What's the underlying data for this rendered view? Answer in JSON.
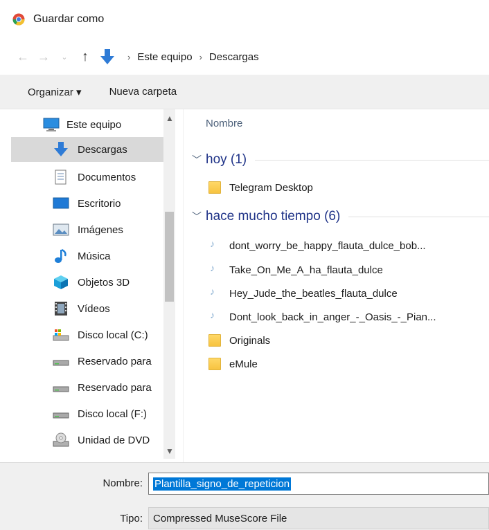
{
  "window": {
    "title": "Guardar como"
  },
  "address": {
    "crumbs": [
      "Este equipo",
      "Descargas"
    ]
  },
  "toolbar": {
    "organize": "Organizar ▾",
    "new_folder": "Nueva carpeta"
  },
  "nav": {
    "items": [
      {
        "label": "Este equipo",
        "icon": "computer-icon"
      },
      {
        "label": "Descargas",
        "icon": "downloads-icon",
        "selected": true
      },
      {
        "label": "Documentos",
        "icon": "document-icon"
      },
      {
        "label": "Escritorio",
        "icon": "desktop-icon"
      },
      {
        "label": "Imágenes",
        "icon": "pictures-icon"
      },
      {
        "label": "Música",
        "icon": "music-icon"
      },
      {
        "label": "Objetos 3D",
        "icon": "3d-objects-icon"
      },
      {
        "label": "Vídeos",
        "icon": "videos-icon"
      },
      {
        "label": "Disco local (C:)",
        "icon": "drive-icon"
      },
      {
        "label": "Reservado para",
        "icon": "drive-icon"
      },
      {
        "label": "Reservado para",
        "icon": "drive-icon"
      },
      {
        "label": "Disco local (F:)",
        "icon": "drive-icon"
      },
      {
        "label": "Unidad de DVD",
        "icon": "dvd-icon"
      }
    ]
  },
  "files": {
    "column_name": "Nombre",
    "groups": [
      {
        "label": "hoy (1)",
        "items": [
          {
            "name": "Telegram Desktop",
            "type": "folder"
          }
        ]
      },
      {
        "label": "hace mucho tiempo (6)",
        "items": [
          {
            "name": "dont_worry_be_happy_flauta_dulce_bob...",
            "type": "mscz"
          },
          {
            "name": "Take_On_Me_A_ha_flauta_dulce",
            "type": "mscz"
          },
          {
            "name": "Hey_Jude_the_beatles_flauta_dulce",
            "type": "mscz"
          },
          {
            "name": "Dont_look_back_in_anger_-_Oasis_-_Pian...",
            "type": "mscz"
          },
          {
            "name": "Originals",
            "type": "folder"
          },
          {
            "name": "eMule",
            "type": "folder"
          }
        ]
      }
    ]
  },
  "form": {
    "name_label": "Nombre:",
    "name_value": "Plantilla_signo_de_repeticion",
    "type_label": "Tipo:",
    "type_value": "Compressed MuseScore File"
  },
  "colors": {
    "accent": "#0078d7",
    "group_header": "#1e3287",
    "selected_nav": "#d9d9d9"
  }
}
